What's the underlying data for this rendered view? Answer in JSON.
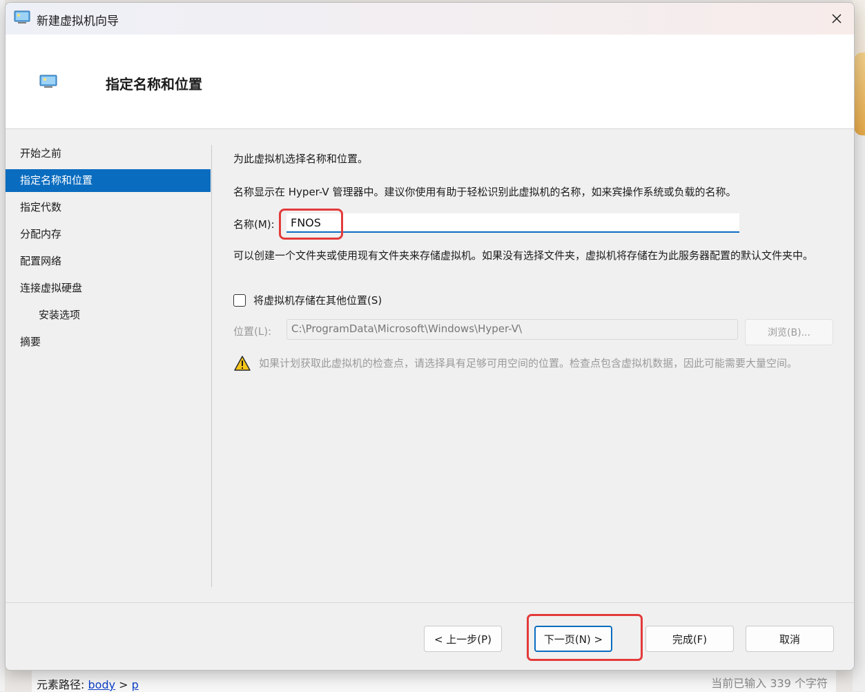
{
  "window": {
    "title": "新建虚拟机向导",
    "page_title": "指定名称和位置"
  },
  "nav": {
    "items": [
      {
        "label": "开始之前"
      },
      {
        "label": "指定名称和位置"
      },
      {
        "label": "指定代数"
      },
      {
        "label": "分配内存"
      },
      {
        "label": "配置网络"
      },
      {
        "label": "连接虚拟硬盘"
      },
      {
        "label": "安装选项"
      },
      {
        "label": "摘要"
      }
    ],
    "active_index": 1
  },
  "main": {
    "intro": "为此虚拟机选择名称和位置。",
    "name_hint": "名称显示在 Hyper-V 管理器中。建议你使用有助于轻松识别此虚拟机的名称，如来宾操作系统或负载的名称。",
    "name_label": "名称(M):",
    "name_value": "FNOS",
    "folder_hint": "可以创建一个文件夹或使用现有文件夹来存储虚拟机。如果没有选择文件夹，虚拟机将存储在为此服务器配置的默认文件夹中。",
    "store_checkbox_label": "将虚拟机存储在其他位置(S)",
    "store_checkbox_checked": false,
    "location_label": "位置(L):",
    "location_value": "C:\\ProgramData\\Microsoft\\Windows\\Hyper-V\\",
    "browse_label": "浏览(B)...",
    "warning_text": "如果计划获取此虚拟机的检查点，请选择具有足够可用空间的位置。检查点包含虚拟机数据，因此可能需要大量空间。"
  },
  "footer": {
    "prev_label": "< 上一步(P)",
    "next_label": "下一页(N) >",
    "finish_label": "完成(F)",
    "cancel_label": "取消"
  },
  "editor_status": {
    "path_label": "元素路径:",
    "path_body": "body",
    "path_sep": ">",
    "path_p": "p",
    "char_count": "当前已输入 339 个字符"
  },
  "colors": {
    "accent": "#0a6cbf",
    "highlight": "#e33a3a"
  }
}
